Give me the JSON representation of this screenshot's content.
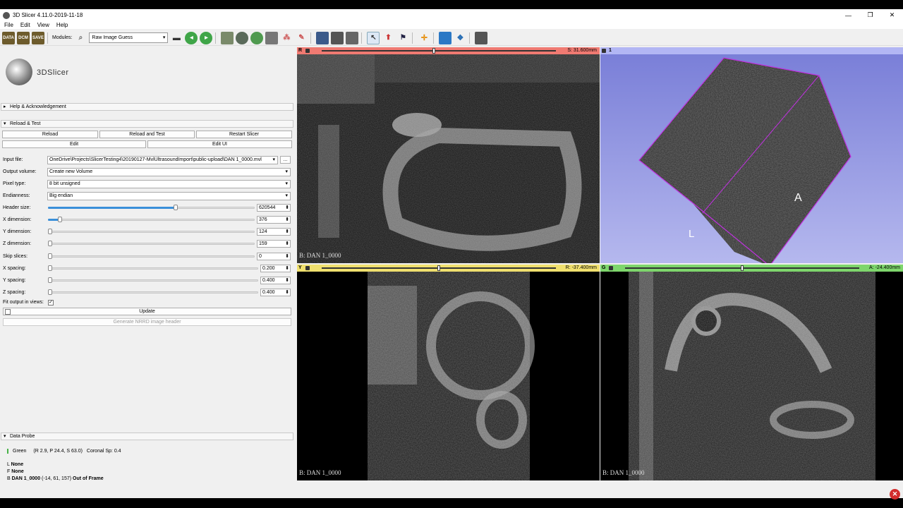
{
  "window": {
    "title": "3D Slicer 4.11.0-2019-11-18",
    "minimize": "—",
    "maximize": "❐",
    "close": "✕"
  },
  "menu": [
    "File",
    "Edit",
    "View",
    "Help"
  ],
  "toolbar": {
    "data_label": "DATA",
    "dcm_label": "DCM",
    "save_label": "SAVE",
    "modules_label": "Modules:",
    "module_selected": "Raw Image Guess"
  },
  "logo_text": "3DSlicer",
  "sections": {
    "help": "Help & Acknowledgement",
    "reload": "Reload & Test",
    "data_probe": "Data Probe"
  },
  "reload_buttons": {
    "reload": "Reload",
    "reload_test": "Reload and Test",
    "restart": "Restart Slicer",
    "edit": "Edit",
    "edit_ui": "Edit UI"
  },
  "form": {
    "input_file_label": "Input file:",
    "input_file_value": "OneDrive\\Projects\\SlicerTesting4\\20190127-MvlUltrasoundImport\\public-upload\\DAN 1_0000.mvl",
    "browse": "...",
    "output_volume_label": "Output volume:",
    "output_volume_value": "Create new Volume",
    "pixel_type_label": "Pixel type:",
    "pixel_type_value": "8 bit unsigned",
    "endianness_label": "Endianness:",
    "endianness_value": "Big endian",
    "header_size_label": "Header size:",
    "header_size_value": "620544",
    "header_size_frac": 0.62,
    "x_dim_label": "X dimension:",
    "x_dim_value": "376",
    "x_dim_frac": 0.05,
    "y_dim_label": "Y dimension:",
    "y_dim_value": "124",
    "y_dim_frac": 0.0,
    "z_dim_label": "Z dimension:",
    "z_dim_value": "159",
    "z_dim_frac": 0.0,
    "skip_label": "Skip slices:",
    "skip_value": "0",
    "skip_frac": 0.0,
    "x_spacing_label": "X spacing:",
    "x_spacing_value": "0.200",
    "x_spacing_frac": 0.0,
    "y_spacing_label": "Y spacing:",
    "y_spacing_value": "0.400",
    "y_spacing_frac": 0.0,
    "z_spacing_label": "Z spacing:",
    "z_spacing_value": "0.400",
    "z_spacing_frac": 0.0,
    "fit_label": "Fit output in views:",
    "fit_checked": "✓",
    "update": "Update",
    "generate": "Generate NRRD image header"
  },
  "probe": {
    "color": "Green",
    "coords": "(R 2.9, P 24.4, S 63.0)",
    "spacing": "Coronal Sp: 0.4",
    "l_prefix": "L",
    "l_value": "None",
    "f_prefix": "F",
    "f_value": "None",
    "b_prefix": "B",
    "b_name": "DAN 1_0000",
    "b_ijk": "(-14,  61, 157)",
    "b_status": "Out of Frame"
  },
  "views": {
    "red": {
      "name": "R",
      "offset": "S: 31.600mm",
      "label": "B: DAN 1_0000",
      "color": "#f07a72",
      "slider": 0.48
    },
    "yellow": {
      "name": "Y",
      "offset": "R: -37.400mm",
      "label": "B: DAN 1_0000",
      "color": "#f0e06e",
      "slider": 0.5
    },
    "green": {
      "name": "G",
      "offset": "A: -24.400mm",
      "label": "B: DAN 1_0000",
      "color": "#7ed66c",
      "slider": 0.5
    },
    "threeD": {
      "name": "1",
      "label_a": "A",
      "label_l": "L",
      "color": "#b2b6f4"
    }
  }
}
